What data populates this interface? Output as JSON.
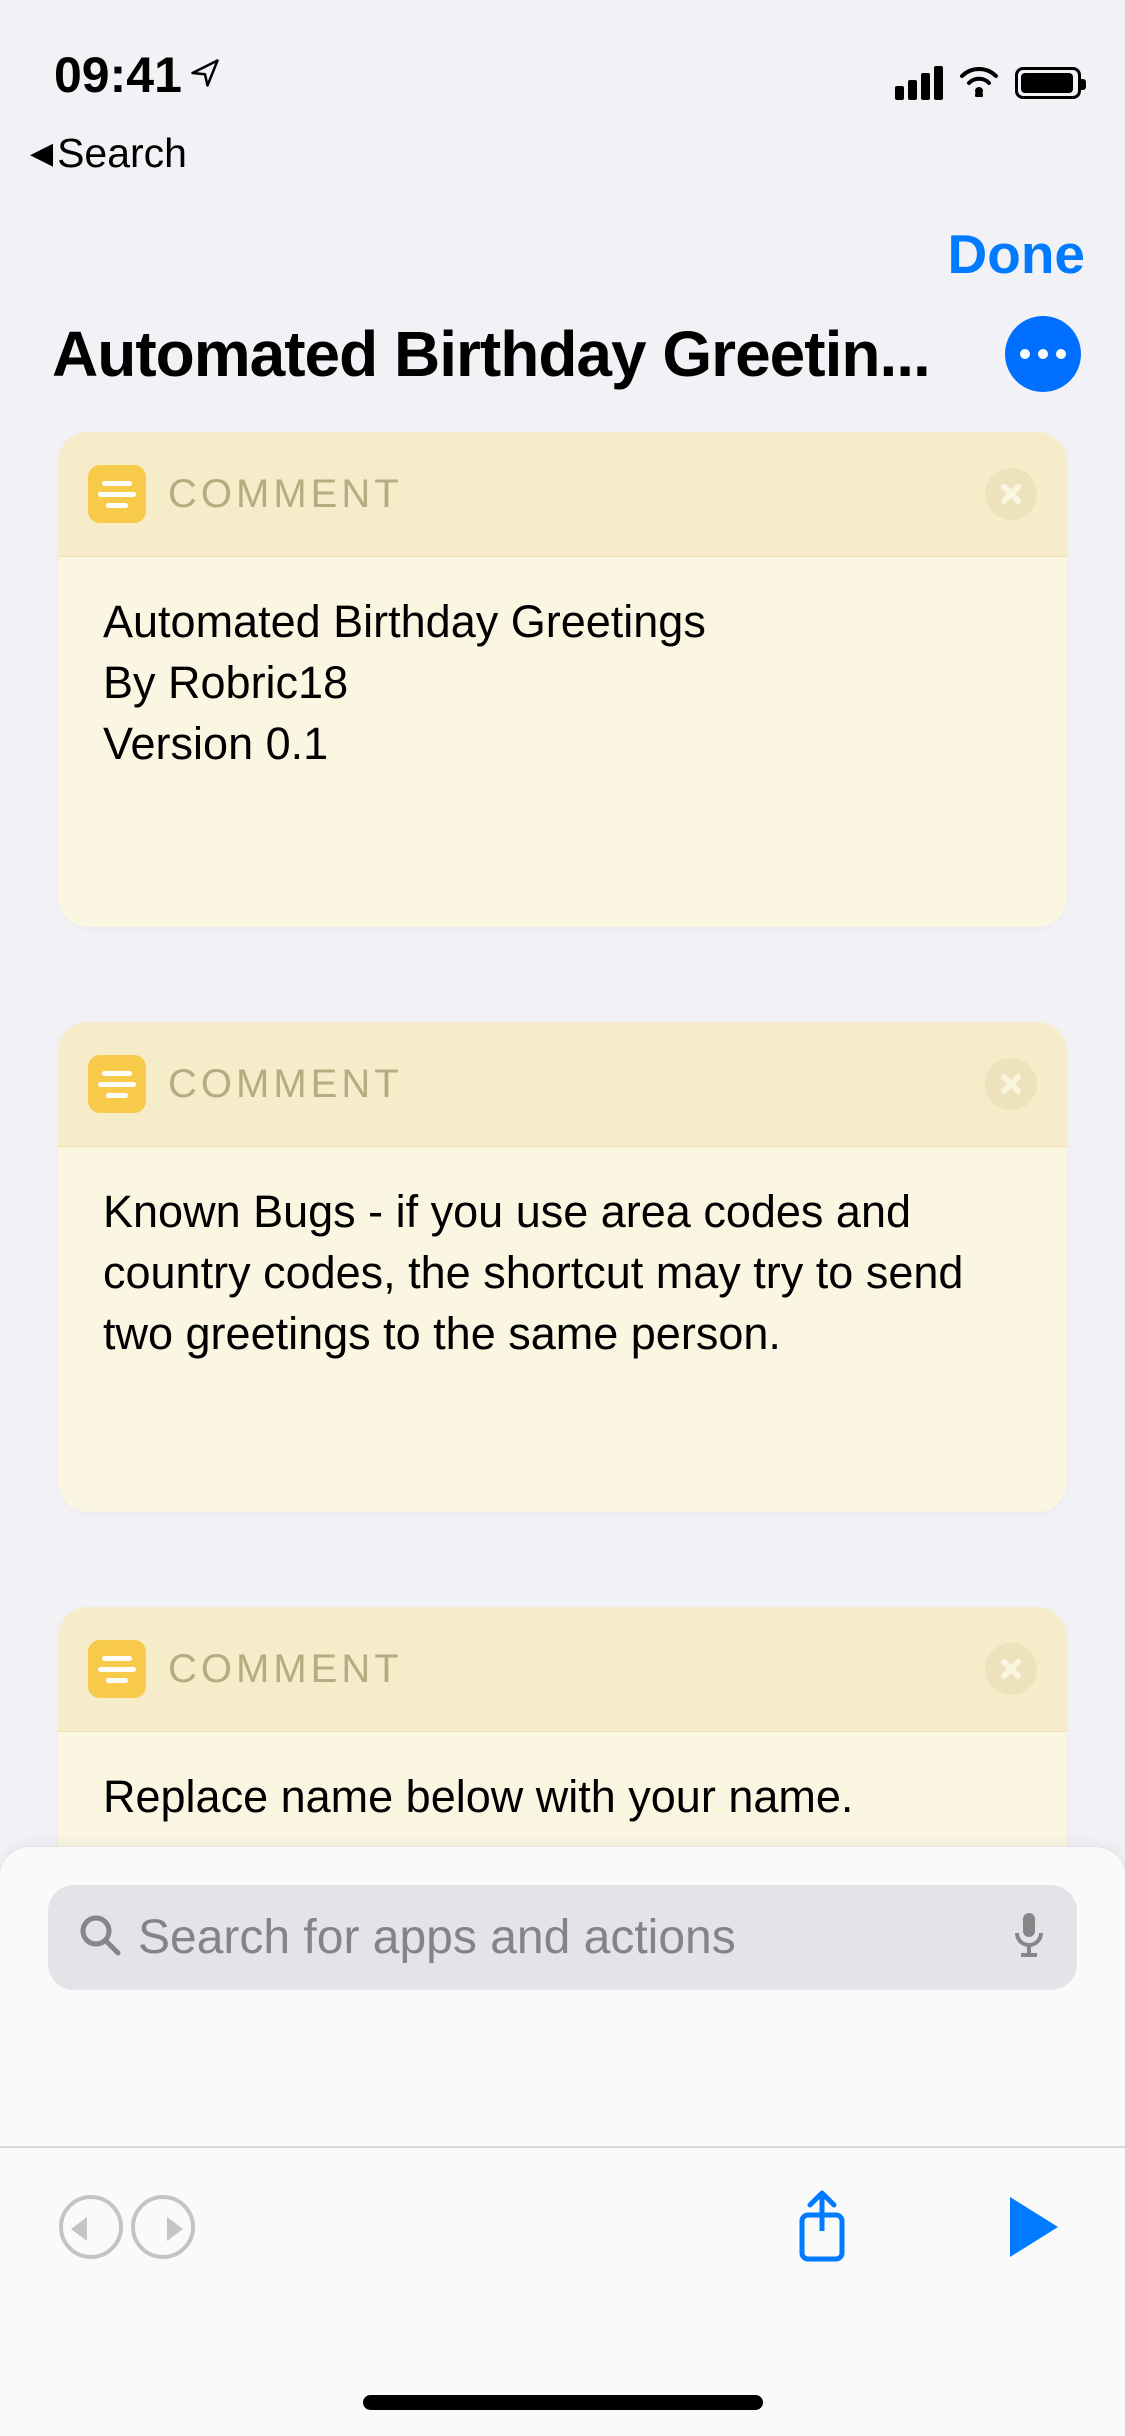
{
  "statusbar": {
    "time": "09:41"
  },
  "back": {
    "label": "Search"
  },
  "header": {
    "done": "Done",
    "title": "Automated Birthday Greetin..."
  },
  "cards": [
    {
      "label": "COMMENT",
      "body": "Automated Birthday Greetings\nBy Robric18\nVersion 0.1"
    },
    {
      "label": "COMMENT",
      "body": "Known Bugs - if you use area codes and country codes, the shortcut may try to send two greetings to the same person."
    },
    {
      "label": "COMMENT",
      "body": "Replace name below with your name."
    }
  ],
  "search": {
    "placeholder": "Search for apps and actions"
  }
}
